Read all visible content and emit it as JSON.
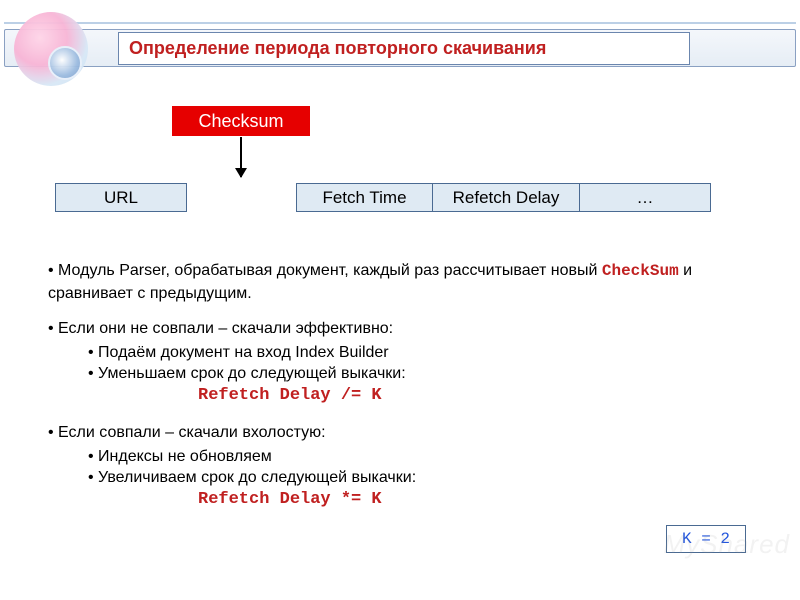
{
  "title": "Определение периода повторного скачивания",
  "checksum_box": "Checksum",
  "cells": {
    "url": "URL",
    "fetch_time": "Fetch Time",
    "refetch_delay": "Refetch Delay",
    "ellipsis": "…"
  },
  "bullets": {
    "b1_pre": "Модуль Parser, обрабатывая  документ, каждый раз рассчитывает новый ",
    "b1_code": "CheckSum",
    "b1_post": " и сравнивает с предыдущим.",
    "b2": "Если они не совпали – скачали эффективно:",
    "b2_sub1": "Подаём документ на вход Index Builder",
    "b2_sub2": "Уменьшаем срок до следующей выкачки:",
    "b2_formula": "Refetch Delay /= K",
    "b3": "Если совпали – скачали вхолостую:",
    "b3_sub1": "Индексы не обновляем",
    "b3_sub2": "Увеличиваем срок до следующей выкачки:",
    "b3_formula": "Refetch Delay *= K"
  },
  "k_box": "K = 2",
  "watermark": "MyShared"
}
